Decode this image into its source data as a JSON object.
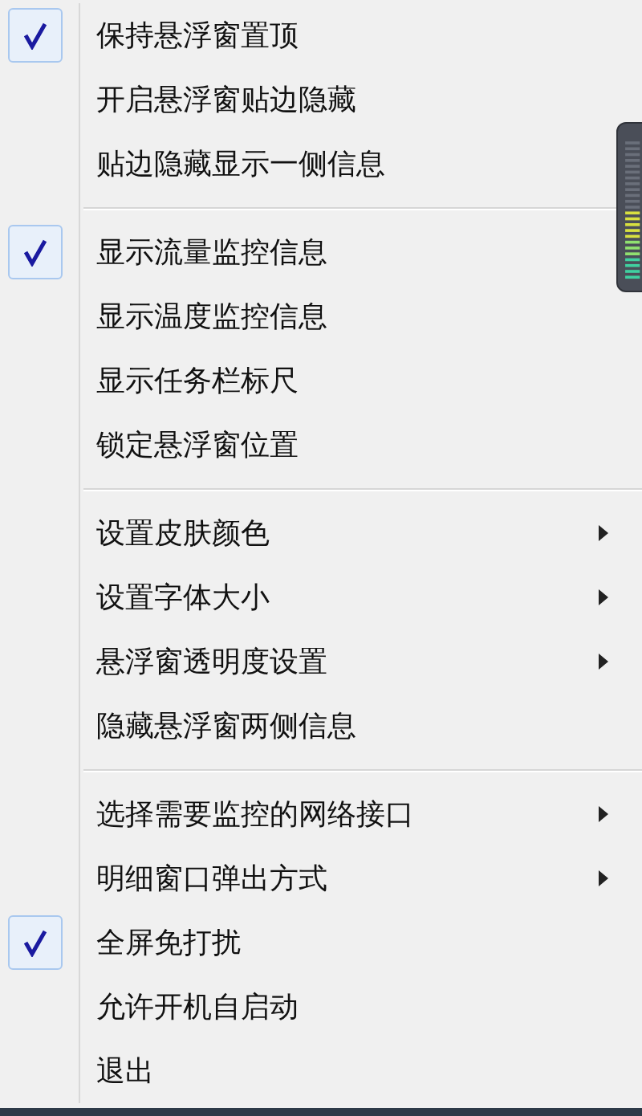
{
  "menu": {
    "sections": [
      {
        "items": [
          {
            "label": "保持悬浮窗置顶",
            "checked": true,
            "submenu": false
          },
          {
            "label": "开启悬浮窗贴边隐藏",
            "checked": false,
            "submenu": false
          },
          {
            "label": "贴边隐藏显示一侧信息",
            "checked": false,
            "submenu": false
          }
        ]
      },
      {
        "items": [
          {
            "label": "显示流量监控信息",
            "checked": true,
            "submenu": false
          },
          {
            "label": "显示温度监控信息",
            "checked": false,
            "submenu": false
          },
          {
            "label": "显示任务栏标尺",
            "checked": false,
            "submenu": false
          },
          {
            "label": "锁定悬浮窗位置",
            "checked": false,
            "submenu": false
          }
        ]
      },
      {
        "items": [
          {
            "label": "设置皮肤颜色",
            "checked": false,
            "submenu": true
          },
          {
            "label": "设置字体大小",
            "checked": false,
            "submenu": true
          },
          {
            "label": "悬浮窗透明度设置",
            "checked": false,
            "submenu": true
          },
          {
            "label": "隐藏悬浮窗两侧信息",
            "checked": false,
            "submenu": false
          }
        ]
      },
      {
        "items": [
          {
            "label": "选择需要监控的网络接口",
            "checked": false,
            "submenu": true
          },
          {
            "label": "明细窗口弹出方式",
            "checked": false,
            "submenu": true
          },
          {
            "label": "全屏免打扰",
            "checked": true,
            "submenu": false
          },
          {
            "label": "允许开机自启动",
            "checked": false,
            "submenu": false
          },
          {
            "label": "退出",
            "checked": false,
            "submenu": false
          }
        ]
      }
    ]
  }
}
